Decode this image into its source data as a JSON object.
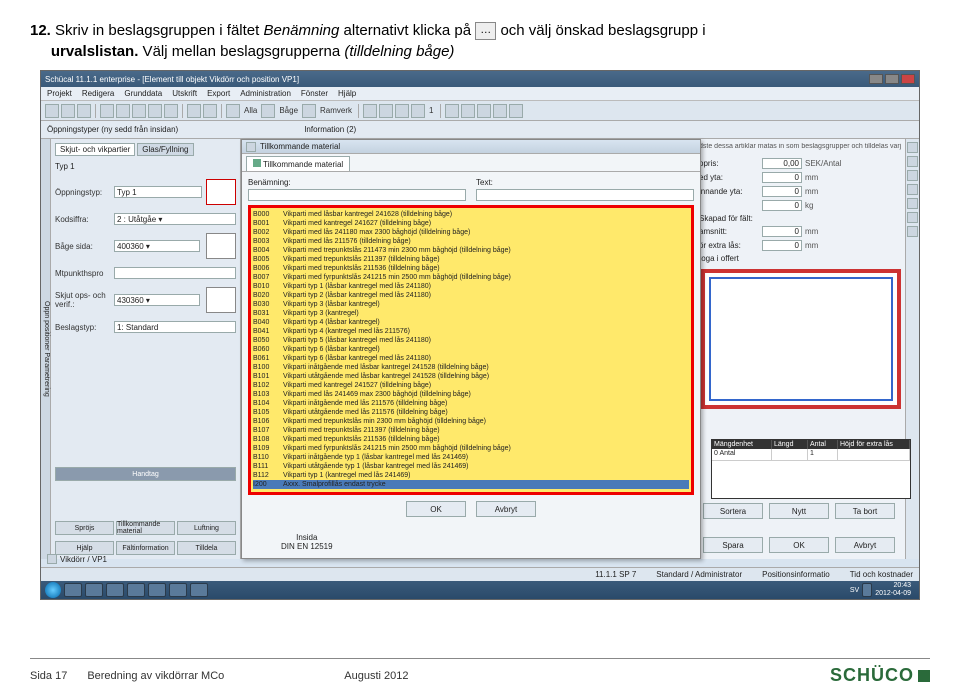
{
  "instruction": {
    "number": "12.",
    "part1": "Skriv in beslagsgruppen i fältet ",
    "field": "Benämning",
    "part2": " alternativt klicka på ",
    "ellipsis": "…",
    "part3": " och välj önskad beslagsgrupp i",
    "line2a": "urvalslistan.",
    "line2b": " Välj mellan beslagsgrupperna ",
    "line2c": "(tilldelning båge)"
  },
  "window": {
    "title": "Schücal 11.1.1 enterprise - [Element till objekt Vikdörr och position VP1]"
  },
  "menu": [
    "Projekt",
    "Redigera",
    "Grunddata",
    "Utskrift",
    "Export",
    "Administration",
    "Fönster",
    "Hjälp"
  ],
  "toolbar_labels": {
    "alla": "Alla",
    "bage": "Båge",
    "ramverk": "Ramverk"
  },
  "subbar": {
    "label1": "Öppningstyper (ny sedd från insidan)",
    "label2": "Information (2)"
  },
  "left": {
    "tabs": {
      "t1": "Skjut- och vikpartier",
      "t2": "Glas/Fyllning"
    },
    "typ1": "Typ 1",
    "r1": {
      "label": "Öppningstyp:",
      "value": "Typ 1"
    },
    "r2": {
      "label": "Kodsiffra:",
      "value": "2 : Utåtgåe ▾"
    },
    "r3": {
      "label": "Båge sida:",
      "value": "400360 ▾"
    },
    "r4": {
      "label": "Mtpunkthspro"
    },
    "r5": {
      "label": "Skjut ops- och verif.:",
      "value": "430360 ▾"
    },
    "r6": {
      "label": "Beslagstyp:",
      "value": "1: Standard"
    },
    "btns": {
      "handtag": "Handtag",
      "sprojs": "Spröjs",
      "tillk": "Tillkommande material",
      "luft": "Luftning",
      "hjalp": "Hjälp",
      "falt": "Fältinformation",
      "tilldela": "Tilldela"
    }
  },
  "dialog": {
    "title": "Tillkommande material",
    "tab": "Tillkommande material",
    "benamning": "Benämning:",
    "text": "Text:",
    "btn_ok": "OK",
    "btn_avbryt": "Avbryt",
    "btn_sortera": "Sortera",
    "btn_nytt": "Nytt",
    "btn_tabort": "Ta bort",
    "btn_spara": "Spara"
  },
  "list": [
    {
      "code": "B000",
      "desc": "Vikparti med låsbar kantregel 241628 (tilldelning båge)"
    },
    {
      "code": "B001",
      "desc": "Vikparti med kantregel 241627 (tilldelning båge)"
    },
    {
      "code": "B002",
      "desc": "Vikparti med lås 241180 max 2300 båghöjd (tilldelning båge)"
    },
    {
      "code": "B003",
      "desc": "Vikparti med lås 211576 (tilldelning båge)"
    },
    {
      "code": "B004",
      "desc": "Vikparti med trepunktslås 211473 min 2300 mm båghöjd (tilldelning båge)"
    },
    {
      "code": "B005",
      "desc": "Vikparti med trepunktslås 211397 (tilldelning båge)"
    },
    {
      "code": "B006",
      "desc": "Vikparti med trepunktslås 211536 (tilldelning båge)"
    },
    {
      "code": "B007",
      "desc": "Vikparti med fyrpunktslås 241215 min 2500 mm båghöjd (tilldelning båge)"
    },
    {
      "code": "B010",
      "desc": "Vikparti typ 1 (låsbar kantregel med lås 241180)"
    },
    {
      "code": "B020",
      "desc": "Vikparti typ 2 (låsbar kantregel med lås 241180)"
    },
    {
      "code": "B030",
      "desc": "Vikparti typ 3 (låsbar kantregel)"
    },
    {
      "code": "B031",
      "desc": "Vikparti typ 3 (kantregel)"
    },
    {
      "code": "B040",
      "desc": "Vikparti typ 4 (låsbar kantregel)"
    },
    {
      "code": "B041",
      "desc": "Vikparti typ 4 (kantregel med lås 211576)"
    },
    {
      "code": "B050",
      "desc": "Vikparti typ 5 (låsbar kantregel med lås 241180)"
    },
    {
      "code": "B060",
      "desc": "Vikparti typ 6 (låsbar kantregel)"
    },
    {
      "code": "B061",
      "desc": "Vikparti typ 6 (låsbar kantregel med lås 241180)"
    },
    {
      "code": "B100",
      "desc": "Vikparti inåtgående med låsbar kantregel 241528 (tilldelning båge)"
    },
    {
      "code": "B101",
      "desc": "Vikparti utåtgående med låsbar kantregel 241528 (tilldelning båge)"
    },
    {
      "code": "B102",
      "desc": "Vikparti med kantregel 241527 (tilldelning båge)"
    },
    {
      "code": "B103",
      "desc": "Vikparti med lås 241469 max 2300 båghöjd (tilldelning båge)"
    },
    {
      "code": "B104",
      "desc": "Vikparti inåtgående med lås 211576 (tilldelning båge)"
    },
    {
      "code": "B105",
      "desc": "Vikparti utåtgående med lås 211576 (tilldelning båge)"
    },
    {
      "code": "B106",
      "desc": "Vikparti med trepunktslås min 2300 mm båghöjd (tilldelning båge)"
    },
    {
      "code": "B107",
      "desc": "Vikparti med trepunktslås 211397 (tilldelning båge)"
    },
    {
      "code": "B108",
      "desc": "Vikparti med trepunktslås 211536 (tilldelning båge)"
    },
    {
      "code": "B109",
      "desc": "Vikparti med fyrpunktslås 241215 min 2500 mm båghöjd (tilldelning båge)"
    },
    {
      "code": "B110",
      "desc": "Vikparti inåtgående typ 1 (låsbar kantregel med lås 241469)"
    },
    {
      "code": "B111",
      "desc": "Vikparti utåtgående typ 1 (låsbar kantregel med lås 241469)"
    },
    {
      "code": "B112",
      "desc": "Vikparti typ 1 (kantregel med lås 241469)"
    },
    {
      "code": "I200",
      "desc": "Axxx. Smalprofillås endast trycke"
    }
  ],
  "right": {
    "note": "dste dessa artiklar matas in som beslagsgrupper och tilldelas varje specifik bå",
    "r1": {
      "label": "opris:",
      "val": "0,00",
      "unit": "SEK/Antal"
    },
    "r2": {
      "label": "ed yta:",
      "val": "0",
      "unit": "mm"
    },
    "r3": {
      "label": "innande yta:",
      "val": "0",
      "unit": "mm"
    },
    "r4": {
      "label": "",
      "val": "0",
      "unit": "kg"
    },
    "r5": {
      "label": "amsnitt:",
      "val": "0",
      "unit": "mm"
    },
    "r6": {
      "label": "ör extra lås:",
      "val": "0",
      "unit": "mm"
    },
    "skapad": "Skapad för fält:",
    "toga": "toga i offert"
  },
  "grid": {
    "h1": "Mängdenhet",
    "h2": "Längd",
    "h3": "Antal",
    "h4": "Höjd för extra lås",
    "cell1": "0 Antal",
    "cell2": "",
    "cell3": "1",
    "cell4": ""
  },
  "insida": {
    "l1": "Insida",
    "l2": "DIN EN 12519"
  },
  "tabbar": "Vikdörr / VP1",
  "status": {
    "v": "11.1.1 SP 7",
    "mode": "Standard / Administrator",
    "p1": "Positionsinformatio",
    "p2": "Tid och kostnader"
  },
  "clock": {
    "lang": "SV",
    "time": "20:43",
    "date": "2012-04-09"
  },
  "footer": {
    "page": "Sida 17",
    "title": "Beredning av vikdörrar MCo",
    "date": "Augusti 2012",
    "brand": "SCHÜCO"
  }
}
